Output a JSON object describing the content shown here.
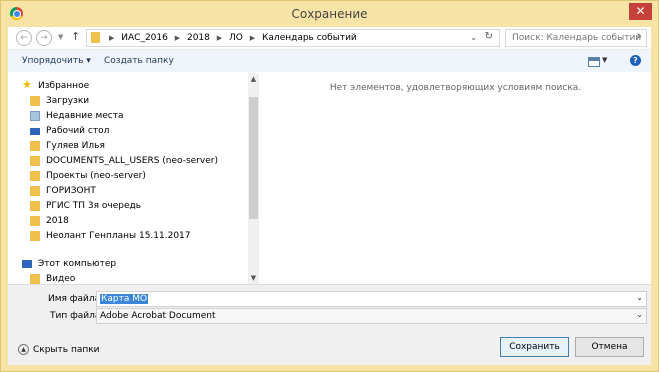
{
  "window": {
    "title": "Сохранение",
    "close": "✕"
  },
  "nav": {
    "back": "←",
    "forward": "→",
    "dropdown": "▼",
    "up": "↑"
  },
  "address": {
    "crumbs": [
      "ИАС_2016",
      "2018",
      "ЛО",
      "Календарь событий"
    ],
    "dropdown": "⌄",
    "refresh": "↻"
  },
  "search": {
    "placeholder": "Поиск: Календарь событий",
    "icon": "⌕"
  },
  "toolbar": {
    "organize": "Упорядочить ▾",
    "new_folder": "Создать папку",
    "view_dd": "▼",
    "help": "?"
  },
  "sidebar": {
    "favorites": "Избранное",
    "items": [
      "Загрузки",
      "Недавние места",
      "Рабочий стол",
      "Гуляев Илья",
      "DOCUMENTS_ALL_USERS (neo-server)",
      "Проекты (neo-server)",
      "ГОРИЗОНТ",
      "РГИС ТП 3я очередь",
      "2018",
      "Неолант Генпланы 15.11.2017"
    ],
    "computer": "Этот компьютер",
    "video": "Видео"
  },
  "scrollbar": {
    "up": "▲",
    "down": "▼"
  },
  "content": {
    "empty_message": "Нет элементов, удовлетворяющих условиям поиска."
  },
  "form": {
    "filename_label": "Имя файла:",
    "filename_value": "Карта МО",
    "filetype_label": "Тип файла:",
    "filetype_value": "Adobe Acrobat Document",
    "dd": "⌄"
  },
  "footer": {
    "hide_folders": "Скрыть папки",
    "hide_icon": "▲",
    "save": "Сохранить",
    "cancel": "Отмена"
  },
  "colors": {
    "frame": "#f7e3a6",
    "close": "#c7413b",
    "selection": "#3a86d8",
    "folder": "#f0c04c"
  }
}
